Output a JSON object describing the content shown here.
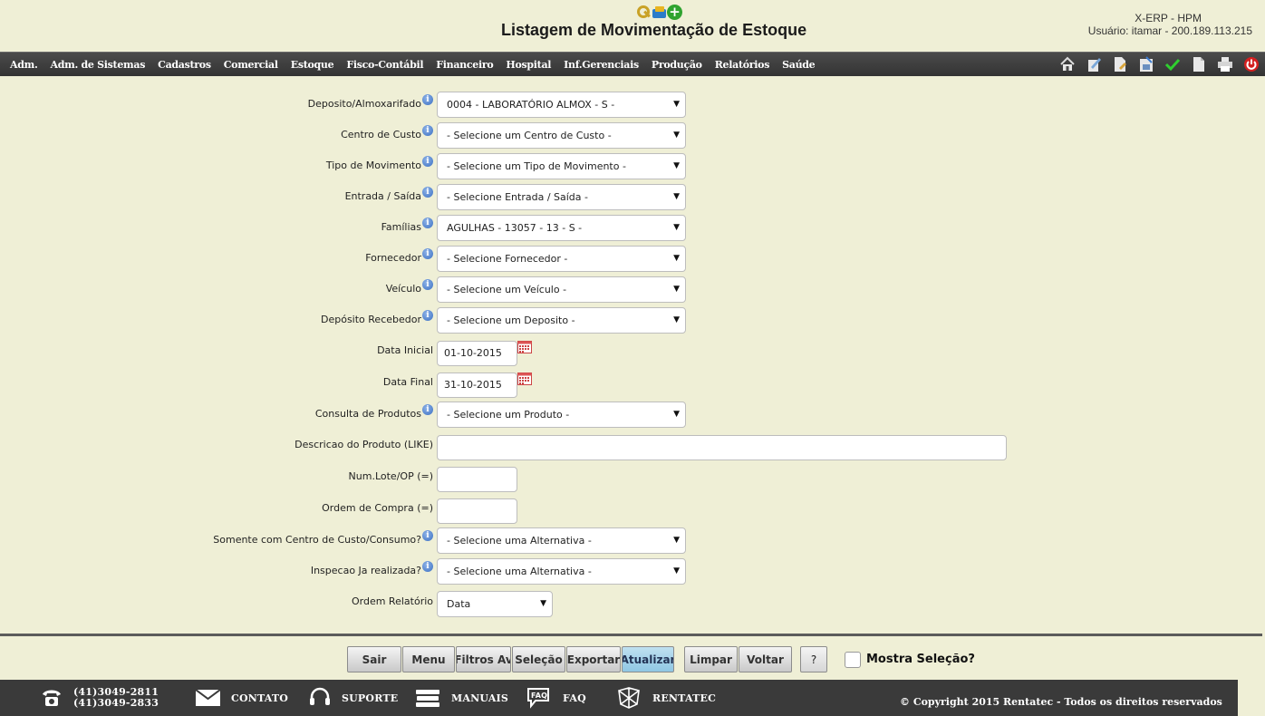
{
  "header": {
    "title": "Listagem de Movimentação de Estoque",
    "system": "X-ERP - HPM",
    "user": "Usuário: itamar - 200.189.113.215"
  },
  "nav": {
    "items": [
      "Adm.",
      "Adm. de Sistemas",
      "Cadastros",
      "Comercial",
      "Estoque",
      "Fisco-Contábil",
      "Financeiro",
      "Hospital",
      "Inf.Gerenciais",
      "Produção",
      "Relatórios",
      "Saúde"
    ]
  },
  "form": {
    "deposito": {
      "label": "Deposito/Almoxarifado",
      "value": "0004 - LABORATÓRIO ALMOX - S -"
    },
    "centro_custo": {
      "label": "Centro de Custo",
      "value": "- Selecione um Centro de Custo -"
    },
    "tipo_movimento": {
      "label": "Tipo de Movimento",
      "value": "- Selecione um Tipo de Movimento -"
    },
    "entrada_saida": {
      "label": "Entrada / Saída",
      "value": "- Selecione Entrada / Saída -"
    },
    "familias": {
      "label": "Famílias",
      "value": "AGULHAS - 13057 - 13 - S -"
    },
    "fornecedor": {
      "label": "Fornecedor",
      "value": "- Selecione Fornecedor -"
    },
    "veiculo": {
      "label": "Veículo",
      "value": "- Selecione um Veículo -"
    },
    "deposito_recebedor": {
      "label": "Depósito Recebedor",
      "value": "- Selecione um Deposito -"
    },
    "data_inicial": {
      "label": "Data Inicial",
      "value": "01-10-2015"
    },
    "data_final": {
      "label": "Data Final",
      "value": "31-10-2015"
    },
    "consulta_produtos": {
      "label": "Consulta de Produtos",
      "value": "- Selecione um Produto -"
    },
    "descricao_produto": {
      "label": "Descricao do Produto (LIKE)",
      "value": ""
    },
    "num_lote": {
      "label": "Num.Lote/OP (=)",
      "value": ""
    },
    "ordem_compra": {
      "label": "Ordem de Compra (=)",
      "value": ""
    },
    "somente_centro": {
      "label": "Somente com Centro de Custo/Consumo?",
      "value": "- Selecione uma Alternativa -"
    },
    "inspecao": {
      "label": "Inspecao Ja realizada?",
      "value": "- Selecione uma Alternativa -"
    },
    "ordem_relatorio": {
      "label": "Ordem Relatório",
      "value": "Data"
    }
  },
  "actions": {
    "sair": "Sair",
    "menu": "Menu",
    "filtros": "Filtros Av",
    "selecao": "Seleção",
    "exportar": "Exportar",
    "atualizar": "Atualizar",
    "limpar": "Limpar",
    "voltar": "Voltar",
    "help": "?",
    "mostra_selecao": "Mostra Seleção?"
  },
  "footer": {
    "phone1": "(41)3049-2811",
    "phone2": "(41)3049-2833",
    "contato": "CONTATO",
    "suporte": "SUPORTE",
    "manuais": "MANUAIS",
    "faq": "FAQ",
    "faq_icon_text": "FAQ",
    "rentatec": "RENTATEC",
    "copyright": "© Copyright 2015 Rentatec - Todos os direitos reservados"
  },
  "colors": {
    "background": "#efefd6",
    "navbar": "#3a3a3a",
    "active_button": "#9fd0e8"
  }
}
